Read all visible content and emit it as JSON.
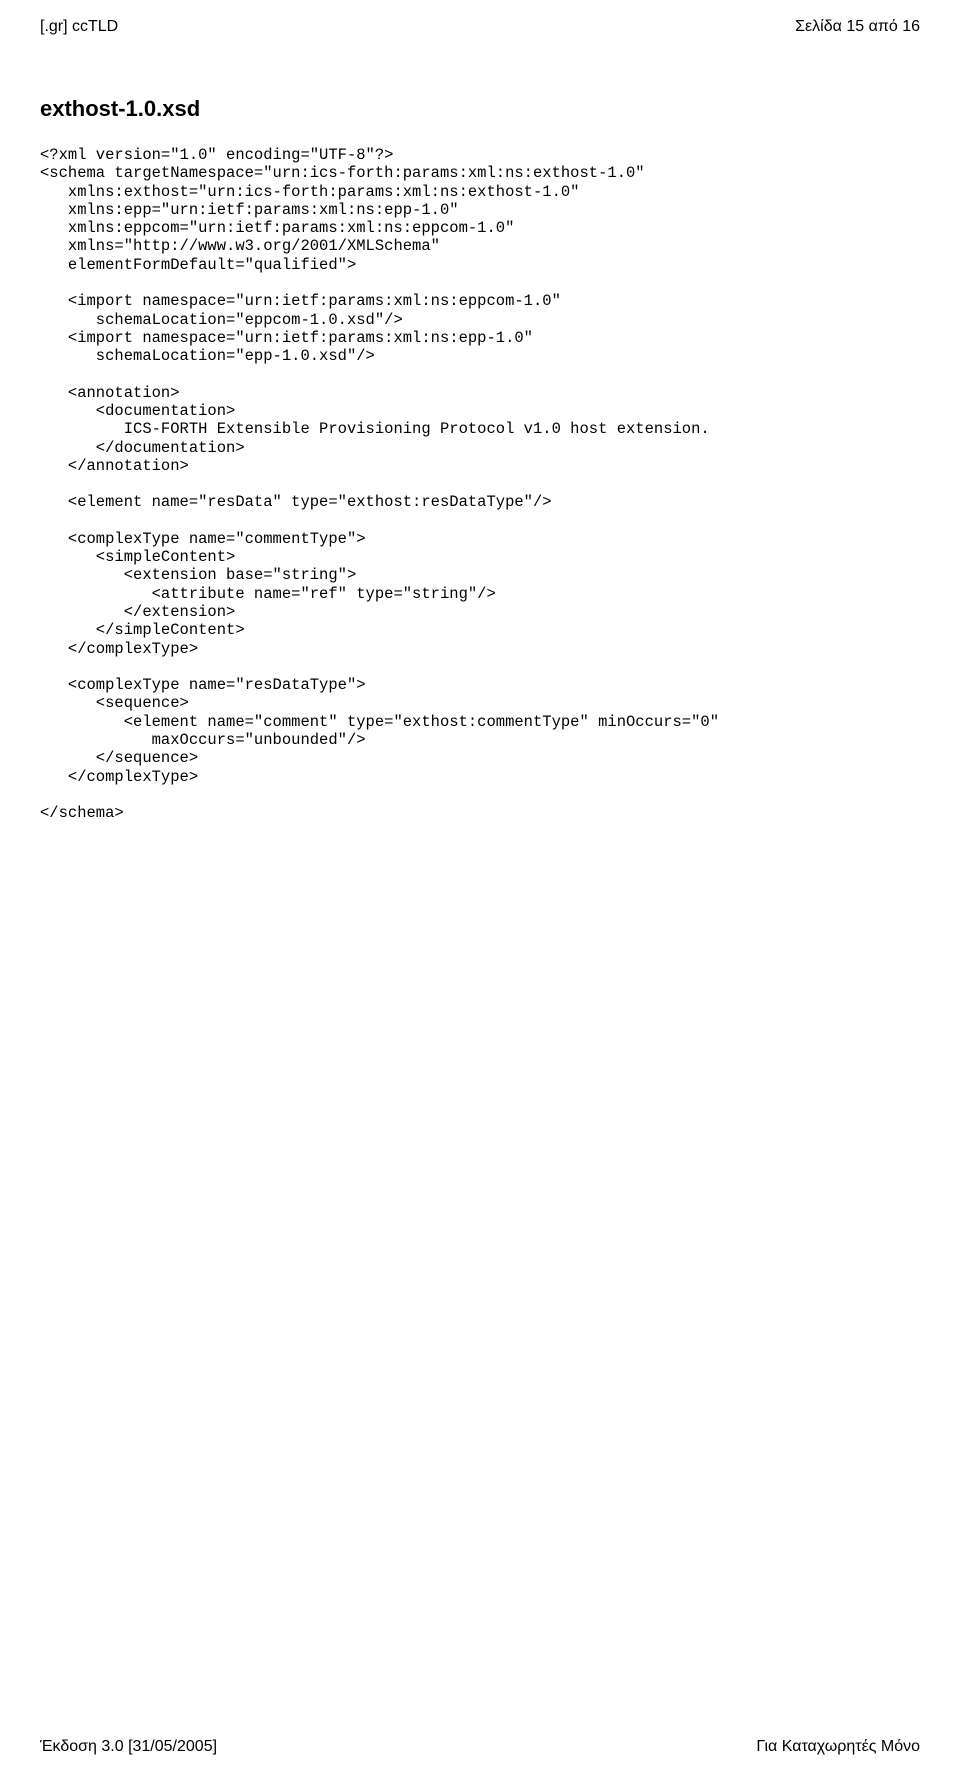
{
  "header": {
    "left": "[.gr] ccTLD",
    "right": "Σελίδα 15 από 16"
  },
  "section_title": "exthost-1.0.xsd",
  "code": "<?xml version=\"1.0\" encoding=\"UTF-8\"?>\n<schema targetNamespace=\"urn:ics-forth:params:xml:ns:exthost-1.0\"\n   xmlns:exthost=\"urn:ics-forth:params:xml:ns:exthost-1.0\"\n   xmlns:epp=\"urn:ietf:params:xml:ns:epp-1.0\"\n   xmlns:eppcom=\"urn:ietf:params:xml:ns:eppcom-1.0\"\n   xmlns=\"http://www.w3.org/2001/XMLSchema\"\n   elementFormDefault=\"qualified\">\n\n   <import namespace=\"urn:ietf:params:xml:ns:eppcom-1.0\"\n      schemaLocation=\"eppcom-1.0.xsd\"/>\n   <import namespace=\"urn:ietf:params:xml:ns:epp-1.0\"\n      schemaLocation=\"epp-1.0.xsd\"/>\n\n   <annotation>\n      <documentation>\n         ICS-FORTH Extensible Provisioning Protocol v1.0 host extension.\n      </documentation>\n   </annotation>\n\n   <element name=\"resData\" type=\"exthost:resDataType\"/>\n\n   <complexType name=\"commentType\">\n      <simpleContent>\n         <extension base=\"string\">\n            <attribute name=\"ref\" type=\"string\"/>\n         </extension>\n      </simpleContent>\n   </complexType>\n\n   <complexType name=\"resDataType\">\n      <sequence>\n         <element name=\"comment\" type=\"exthost:commentType\" minOccurs=\"0\"\n            maxOccurs=\"unbounded\"/>\n      </sequence>\n   </complexType>\n\n</schema>",
  "footer": {
    "left": "Έκδοση 3.0 [31/05/2005]",
    "right": "Για Καταχωρητές Μόνο"
  }
}
